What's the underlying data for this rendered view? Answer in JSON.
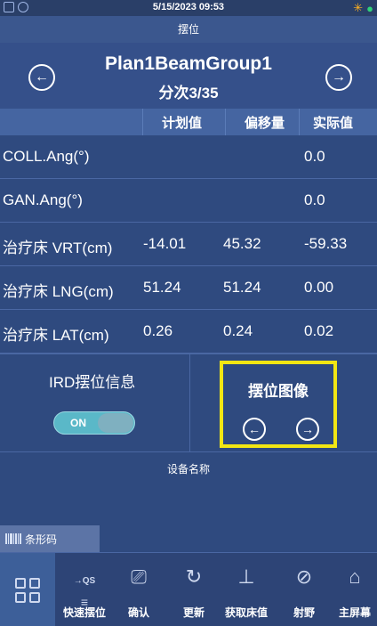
{
  "status": {
    "datetime": "5/15/2023  09:53"
  },
  "title": "摆位",
  "plan": {
    "name": "Plan1BeamGroup1",
    "fraction": "分次3/35"
  },
  "columns": [
    "计划值",
    "偏移量",
    "实际值"
  ],
  "rows": [
    {
      "label": "COLL.Ang(°)",
      "plan": "",
      "offset": "",
      "actual": "0.0"
    },
    {
      "label": "GAN.Ang(°)",
      "plan": "",
      "offset": "",
      "actual": "0.0"
    },
    {
      "label": "治疗床 VRT(cm)",
      "plan": "-14.01",
      "offset": "45.32",
      "actual": "-59.33"
    },
    {
      "label": "治疗床 LNG(cm)",
      "plan": "51.24",
      "offset": "51.24",
      "actual": "0.00"
    },
    {
      "label": "治疗床 LAT(cm)",
      "plan": "0.26",
      "offset": "0.24",
      "actual": "0.02"
    }
  ],
  "ird": {
    "label": "IRD摆位信息",
    "toggle": "ON"
  },
  "setup_image": {
    "label": "摆位图像"
  },
  "device_label": "设备名称",
  "barcode_label": "条形码",
  "toolbar": [
    {
      "icon_text": "→QS",
      "label": "快速摆位"
    },
    {
      "label": "确认"
    },
    {
      "label": "更新"
    },
    {
      "label": "获取床值"
    },
    {
      "label": "射野"
    },
    {
      "label": "主屏幕"
    }
  ],
  "colors": {
    "highlight": "#f2e613",
    "background": "#2f4a7f",
    "toggle_on": "#5ab8c8"
  }
}
